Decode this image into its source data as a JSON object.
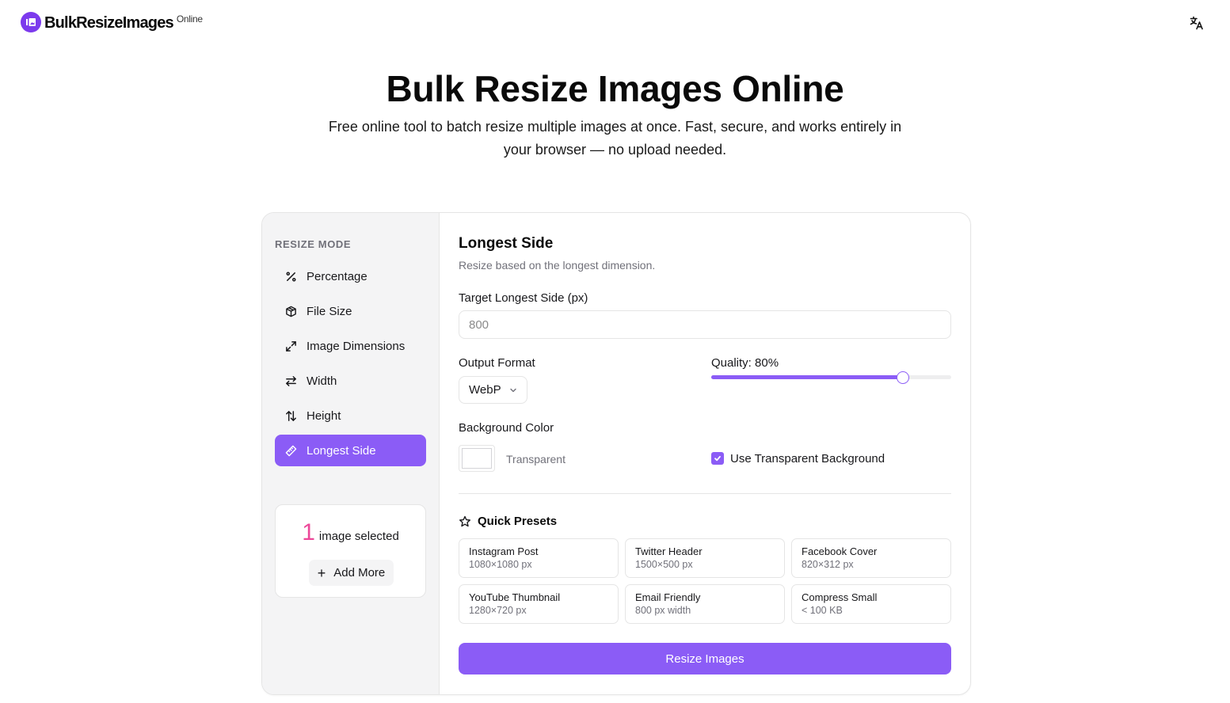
{
  "header": {
    "brand_name": "BulkResizeImages",
    "brand_suffix": "Online",
    "logo_icon": "image-icon",
    "language_icon": "translate-icon"
  },
  "hero": {
    "title": "Bulk Resize Images Online",
    "subtitle": "Free online tool to batch resize multiple images at once. Fast, secure, and works entirely in your browser — no upload needed."
  },
  "sidebar": {
    "label": "RESIZE MODE",
    "items": [
      {
        "label": "Percentage",
        "icon": "percent-icon",
        "active": false
      },
      {
        "label": "File Size",
        "icon": "package-icon",
        "active": false
      },
      {
        "label": "Image Dimensions",
        "icon": "expand-icon",
        "active": false
      },
      {
        "label": "Width",
        "icon": "arrows-horizontal-icon",
        "active": false
      },
      {
        "label": "Height",
        "icon": "arrows-vertical-icon",
        "active": false
      },
      {
        "label": "Longest Side",
        "icon": "ruler-icon",
        "active": true
      }
    ],
    "selection": {
      "count": "1",
      "text": "image selected",
      "add_more": "Add More"
    }
  },
  "main": {
    "title": "Longest Side",
    "description": "Resize based on the longest dimension.",
    "target_label": "Target Longest Side (px)",
    "target_placeholder": "800",
    "format_label": "Output Format",
    "format_value": "WebP",
    "quality_label": "Quality: 80%",
    "quality_value": 80,
    "bg_label": "Background Color",
    "bg_swatch_text": "Transparent",
    "bg_color": "#ffffff",
    "transparent_label": "Use Transparent Background",
    "transparent_checked": true,
    "presets_title": "Quick Presets",
    "presets": [
      {
        "name": "Instagram Post",
        "size": "1080×1080 px"
      },
      {
        "name": "Twitter Header",
        "size": "1500×500 px"
      },
      {
        "name": "Facebook Cover",
        "size": "820×312 px"
      },
      {
        "name": "YouTube Thumbnail",
        "size": "1280×720 px"
      },
      {
        "name": "Email Friendly",
        "size": "800 px width"
      },
      {
        "name": "Compress Small",
        "size": "< 100 KB"
      }
    ],
    "submit_label": "Resize Images"
  },
  "colors": {
    "accent": "#8b5cf6",
    "brand": "#7c3aed",
    "count_highlight": "#ec4899"
  }
}
